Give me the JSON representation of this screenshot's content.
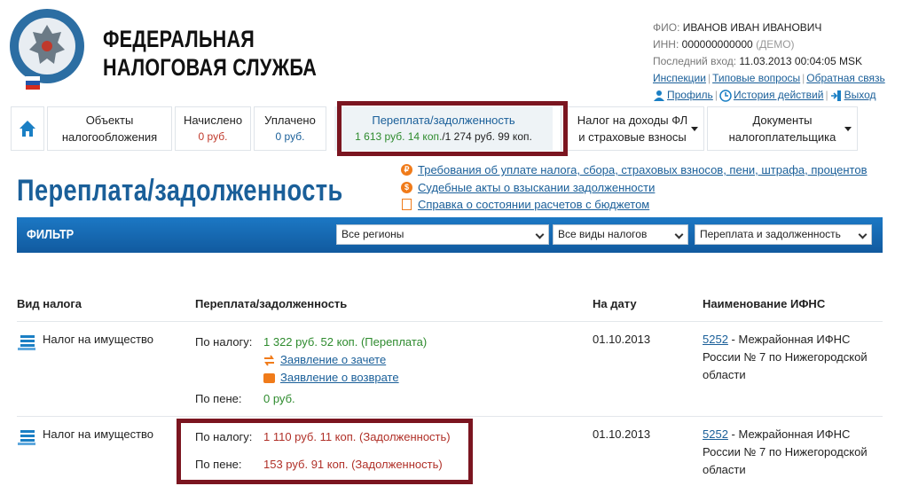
{
  "header": {
    "brand_line1": "ФЕДЕРАЛЬНАЯ",
    "brand_line2": "НАЛОГОВАЯ СЛУЖБА",
    "user": {
      "fio_label": "ФИО:",
      "fio": "ИВАНОВ ИВАН ИВАНОВИЧ",
      "inn_label": "ИНН:",
      "inn": "000000000000",
      "inn_note": "(ДЕМО)",
      "last_login_label": "Последний вход:",
      "last_login": "11.03.2013 00:04:05 MSK",
      "link_instructions": "Инспекции",
      "link_faq": "Типовые вопросы",
      "link_feedback": "Обратная связь",
      "link_profile": "Профиль",
      "link_history": "История действий",
      "link_exit": "Выход"
    }
  },
  "tabs": [
    {
      "title": "Объекты налогообложения"
    },
    {
      "title": "Начислено",
      "sum": "0 руб."
    },
    {
      "title": "Уплачено",
      "sum": "0 руб."
    },
    {
      "title": "Переплата/задолженность",
      "sum_overpay": "1 613 руб. 14 коп.",
      "sum_sep": "/",
      "sum_debt": "1 274 руб. 99 коп."
    },
    {
      "title": "Налог на доходы ФЛ и страховые взносы"
    },
    {
      "title": "Документы налогоплательщика"
    }
  ],
  "page_title": "Переплата/задолженность",
  "doc_links": [
    "Требования об уплате налога, сбора, страховых взносов, пени, штрафа, процентов",
    "Судебные акты о взыскании задолженности",
    "Справка о состоянии расчетов с бюджетом"
  ],
  "filter": {
    "label": "ФИЛЬТР",
    "region": "Все регионы",
    "tax_type": "Все виды налогов",
    "status": "Переплата и задолженность"
  },
  "table": {
    "headers": [
      "Вид налога",
      "Переплата/задолженность",
      "На дату",
      "Наименование ИФНС"
    ],
    "rows": [
      {
        "tax": "Налог на имущество",
        "by_tax_label": "По налогу:",
        "by_tax": "1 322 руб. 52 коп. (Переплата)",
        "action1": "Заявление о зачете",
        "action2": "Заявление о возврате",
        "by_penalty_label": "По пене:",
        "by_penalty": "0 руб.",
        "date": "01.10.2013",
        "ifns_code": "5252",
        "ifns_name": " - Межрайонная ИФНС России № 7 по Нижегородской области"
      },
      {
        "tax": "Налог на имущество",
        "by_tax_label": "По налогу:",
        "by_tax": "1 110 руб. 11 коп. (Задолженность)",
        "by_penalty_label": "По пене:",
        "by_penalty": "153 руб. 91 коп. (Задолженность)",
        "date": "01.10.2013",
        "ifns_code": "5252",
        "ifns_name": " - Межрайонная ИФНС России № 7 по Нижегородской области"
      }
    ]
  },
  "colors": {
    "brand_blue": "#1a5f99",
    "highlight": "#7b1520",
    "overpay_green": "#2e8b2e",
    "debt_red": "#b03028",
    "accent_orange": "#f07b1a"
  },
  "icons": [
    "fns-emblem-logo",
    "home-icon",
    "profile-icon",
    "history-icon",
    "exit-icon",
    "ruble-coin-icon",
    "court-bag-icon",
    "document-icon",
    "tax-doc-icon",
    "offset-icon",
    "refund-icon"
  ]
}
